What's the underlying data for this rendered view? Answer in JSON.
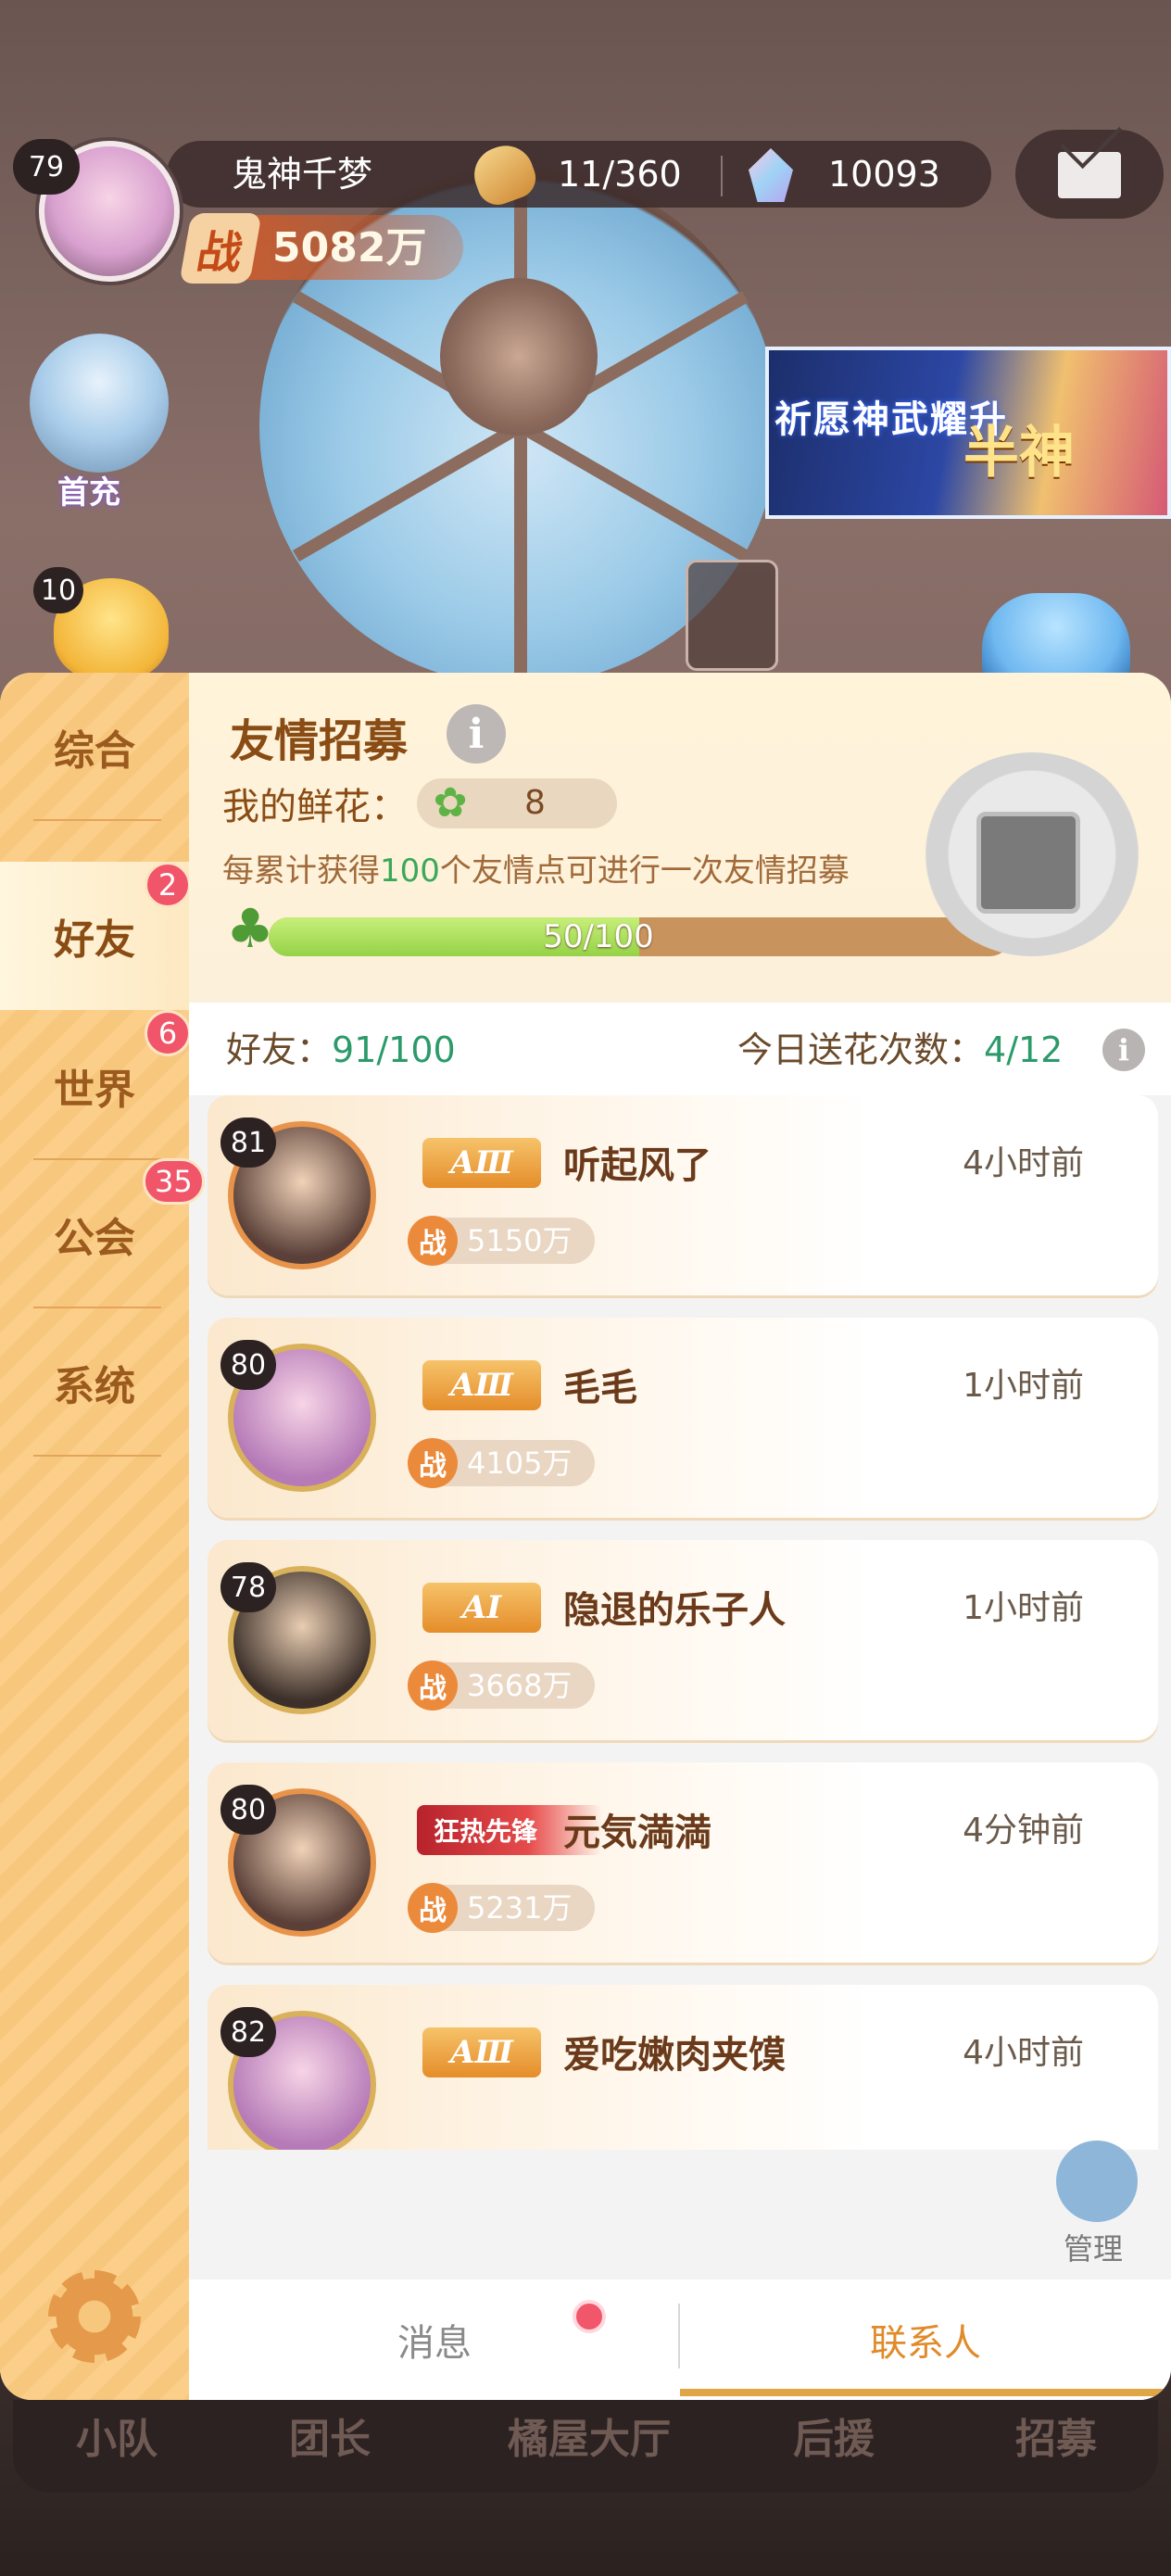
{
  "player": {
    "level": "79",
    "name": "鬼神千梦",
    "stamina": "11/360",
    "gems": "10093",
    "power_icon": "战",
    "power": "5082万"
  },
  "side_buttons": {
    "first_charge_label": "首充",
    "pet_level": "10"
  },
  "banner": {
    "text_left": "祈愿神武耀升",
    "text_right": "半神"
  },
  "nav": {
    "items": [
      {
        "label": "综合",
        "badge": ""
      },
      {
        "label": "好友",
        "badge": "2"
      },
      {
        "label": "世界",
        "badge": "6"
      },
      {
        "label": "公会",
        "badge": "35"
      },
      {
        "label": "系统",
        "badge": ""
      }
    ],
    "selected": "好友"
  },
  "recruit": {
    "title": "友情招募",
    "flower_label": "我的鲜花：",
    "flower_value": "8",
    "desc_pre": "每累计获得",
    "desc_num": "100",
    "desc_post": "个友情点可进行一次友情招募",
    "progress_text": "50/100",
    "progress_fraction": 0.5
  },
  "friends_header": {
    "friends_label": "好友：",
    "friends_value": "91/100",
    "send_label": "今日送花次数：",
    "send_value": "4/12"
  },
  "friends": [
    {
      "level": "81",
      "rank": "AⅢ",
      "name": "听起风了",
      "time": "4小时前",
      "power_icon": "战",
      "power": "5150万"
    },
    {
      "level": "80",
      "rank": "AⅢ",
      "name": "毛毛",
      "time": "1小时前",
      "power_icon": "战",
      "power": "4105万"
    },
    {
      "level": "78",
      "rank": "AⅠ",
      "name": "隐退的乐子人",
      "time": "1小时前",
      "power_icon": "战",
      "power": "3668万"
    },
    {
      "level": "80",
      "rank": "狂热先锋",
      "name": "元気満満",
      "time": "4分钟前",
      "power_icon": "战",
      "power": "5231万"
    },
    {
      "level": "82",
      "rank": "AⅢ",
      "name": "爱吃嫩肉夹馍",
      "time": "4小时前",
      "power_icon": "",
      "power": ""
    }
  ],
  "manage_label": "管理",
  "tabs": {
    "messages": "消息",
    "contacts": "联系人"
  },
  "bottom_nav": [
    "小队",
    "团长",
    "橘屋大厅",
    "后援",
    "招募"
  ],
  "colors": {
    "accent": "#e08a2a",
    "nav_bg": "#f8c77e",
    "badge": "#f0556a",
    "highlight_green": "#2c9a6a"
  }
}
